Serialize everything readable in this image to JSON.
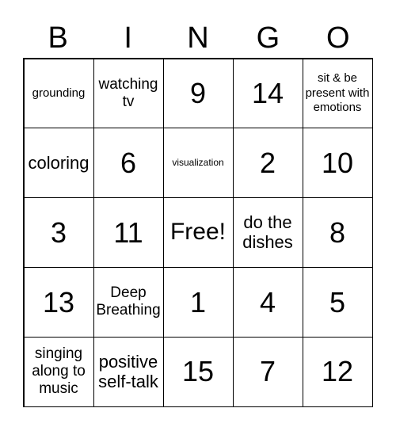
{
  "header": [
    "B",
    "I",
    "N",
    "G",
    "O"
  ],
  "cells": [
    "grounding",
    "watching tv",
    "9",
    "14",
    "sit & be present with emotions",
    "coloring",
    "6",
    "visualization",
    "2",
    "10",
    "3",
    "11",
    "Free!",
    "do the dishes",
    "8",
    "13",
    "Deep Breathing",
    "1",
    "4",
    "5",
    "singing along to music",
    "positive self-talk",
    "15",
    "7",
    "12"
  ]
}
